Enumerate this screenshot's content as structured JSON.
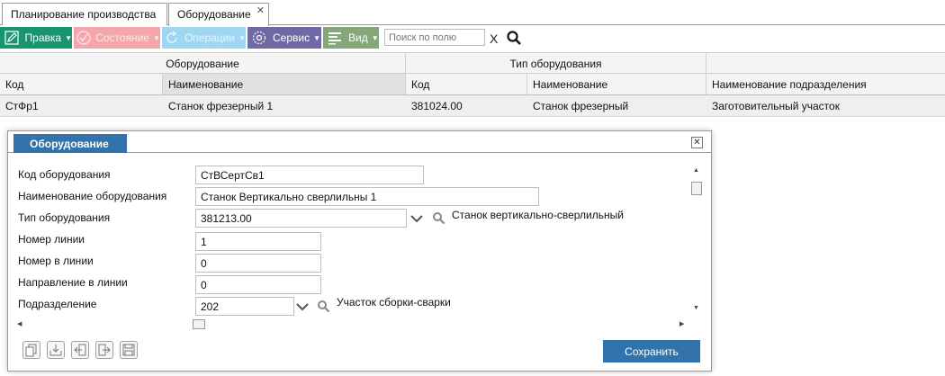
{
  "tabs": [
    {
      "label": "Планирование производства"
    },
    {
      "label": "Оборудование",
      "close": "✕"
    }
  ],
  "toolbar": {
    "edit_label": "Правка",
    "state_label": "Состояние",
    "operations_label": "Операции",
    "service_label": "Сервис",
    "view_label": "Вид",
    "search_placeholder": "Поиск по полю",
    "clear_label": "X",
    "colors": {
      "edit": "#1a9470",
      "state": "#f4a6ad",
      "operations": "#9fd6f2",
      "service": "#6f6aa6",
      "view": "#86a878"
    }
  },
  "grid": {
    "group_headers": [
      "Оборудование",
      "Тип оборудования"
    ],
    "columns": [
      "Код",
      "Наименование",
      "Код",
      "Наименование",
      "Наименование подразделения"
    ],
    "rows": [
      [
        "СтФр1",
        "Станок фрезерный 1",
        "381024.00",
        "Станок фрезерный",
        "Заготовительный участок"
      ]
    ]
  },
  "modal": {
    "tab_label": "Оборудование",
    "close_label": "✕",
    "fields": {
      "code_label": "Код оборудования",
      "code_value": "СтВСертСв1",
      "name_label": "Наименование оборудования",
      "name_value": "Станок Вертикально сверлильны 1",
      "type_label": "Тип оборудования",
      "type_value": "381213.00",
      "type_text": "Станок вертикально-сверлильный",
      "line_no_label": "Номер линии",
      "line_no_value": "1",
      "line_pos_label": "Номер в линии",
      "line_pos_value": "0",
      "line_dir_label": "Направление в линии",
      "line_dir_value": "0",
      "dept_label": "Подразделение",
      "dept_value": "202",
      "dept_text": "Участок сборки-сварки"
    },
    "save_label": "Сохранить",
    "accent": "#3273ac"
  }
}
